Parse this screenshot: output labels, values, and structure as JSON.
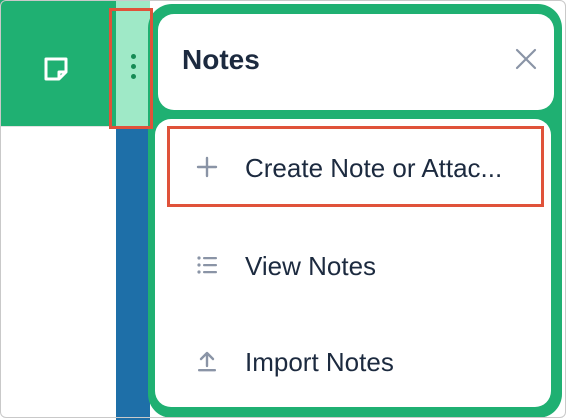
{
  "app": {
    "note_icon": "sticky-note-icon",
    "more_icon": "vertical-dots-icon"
  },
  "notes_panel": {
    "title": "Notes",
    "close_icon": "close-icon",
    "items": [
      {
        "label": "Create Note or Attac...",
        "icon": "plus-icon"
      },
      {
        "label": "View Notes",
        "icon": "list-icon"
      },
      {
        "label": "Import Notes",
        "icon": "upload-icon"
      }
    ]
  },
  "colors": {
    "brand_green": "#1fb072",
    "highlight": "#e0523a",
    "blue_strip": "#1e6fa8",
    "text": "#1c2a3f"
  }
}
